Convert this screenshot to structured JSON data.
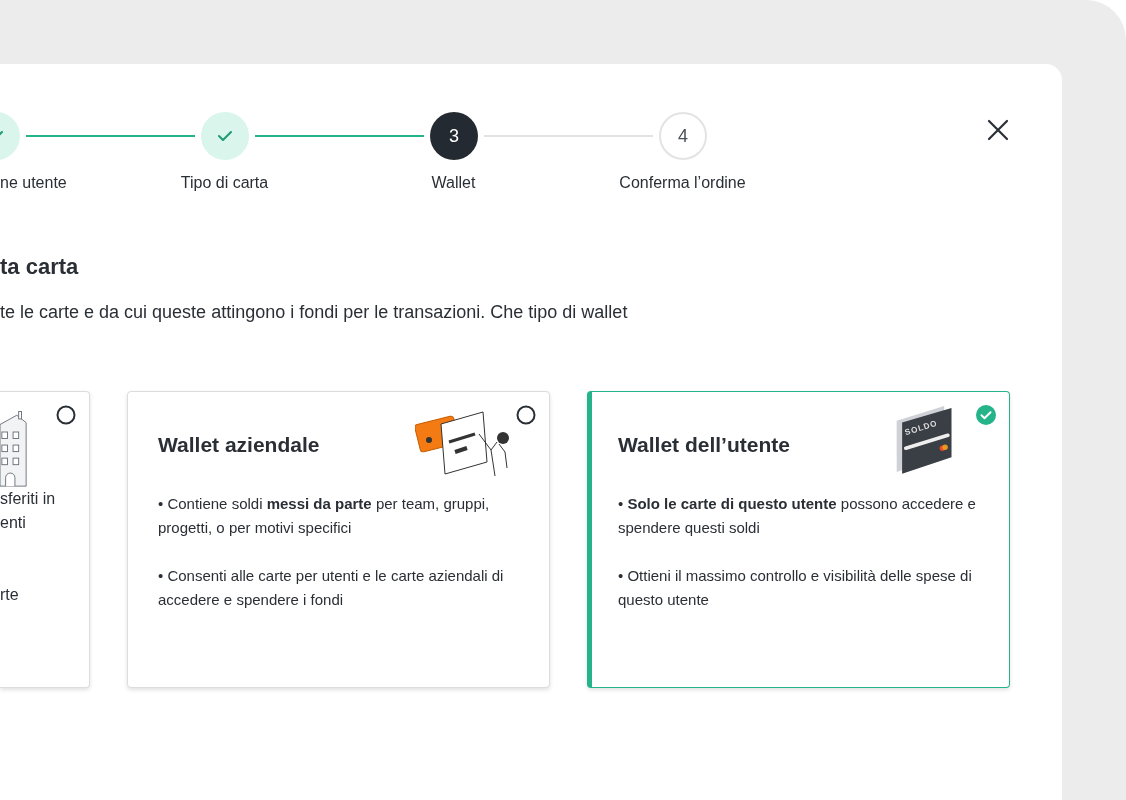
{
  "stepper": {
    "steps": [
      {
        "label": "ne utente",
        "done": true,
        "current": false
      },
      {
        "label": "Tipo di carta",
        "done": true,
        "current": false
      },
      {
        "label": "Wallet",
        "done": false,
        "current": true,
        "number": "3"
      },
      {
        "label": "Conferma l’ordine",
        "done": false,
        "current": false,
        "number": "4"
      }
    ]
  },
  "heading": "ta carta",
  "description": "te le carte e da cui queste attingono i fondi per le transazioni. Che tipo di wallet",
  "cards": [
    {
      "kind": "building",
      "selected": false,
      "paragraphs": [
        [
          "sferiti in",
          "enti"
        ],
        [
          "rte"
        ]
      ]
    },
    {
      "kind": "wallet",
      "selected": false,
      "title": "Wallet aziendale",
      "bullets": [
        "• Contiene soldi **messi da parte** per team, gruppi, progetti, o per motivi specifici",
        "• Consenti alle carte per utenti e le carte aziendali di accedere e spendere i fondi"
      ]
    },
    {
      "kind": "card",
      "selected": true,
      "title": "Wallet dell’utente",
      "card_brand": "SOLDO",
      "bullets": [
        "• **Solo le carte di questo utente** possono accedere e spendere questi soldi",
        "• Ottieni il massimo controllo e visibilità delle spese di questo utente"
      ]
    }
  ]
}
